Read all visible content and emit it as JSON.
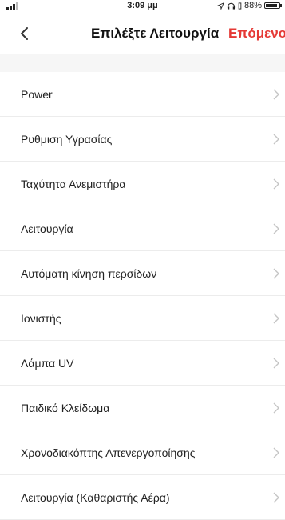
{
  "status_bar": {
    "time": "3:09 μμ",
    "battery": "88%",
    "battery_level": 0.88
  },
  "nav": {
    "title": "Επιλέξτε Λειτουργία",
    "next_label": "Επόμενο"
  },
  "functions": [
    {
      "label": "Power"
    },
    {
      "label": "Ρυθμιση Υγρασίας"
    },
    {
      "label": "Ταχύτητα Ανεμιστήρα"
    },
    {
      "label": "Λειτουργία"
    },
    {
      "label": "Αυτόματη κίνηση περσίδων"
    },
    {
      "label": "Ιονιστής"
    },
    {
      "label": "Λάμπα UV"
    },
    {
      "label": "Παιδικό Κλείδωμα"
    },
    {
      "label": "Χρονοδιακόπτης Απενεργοποίησης"
    },
    {
      "label": "Λειτουργία (Καθαριστής Αέρα)"
    }
  ],
  "colors": {
    "accent": "#e53935",
    "background": "#ffffff",
    "section_gap": "#f6f6f6"
  }
}
